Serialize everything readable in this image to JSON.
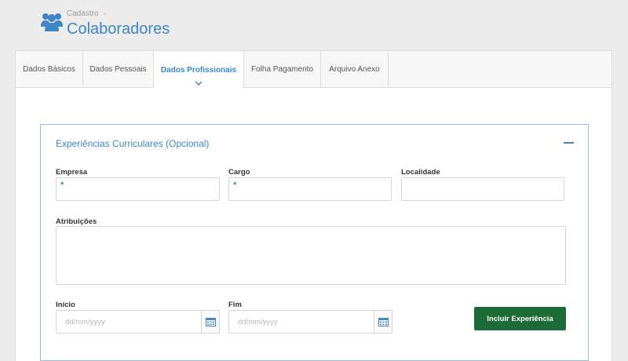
{
  "header": {
    "breadcrumb": "Cadastro",
    "title": "Colaboradores",
    "icon": "people-icon"
  },
  "tabs": [
    {
      "label": "Dados Básicos",
      "active": false
    },
    {
      "label": "Dados Pessoais",
      "active": false
    },
    {
      "label": "Dados Profissionais",
      "active": true
    },
    {
      "label": "Folha Pagamento",
      "active": false
    },
    {
      "label": "Arquivo Anexo",
      "active": false
    }
  ],
  "panel": {
    "title": "Experiências Curriculares (Opcional)",
    "fields": {
      "empresa": {
        "label": "Empresa",
        "value": "",
        "required_mark": "*"
      },
      "cargo": {
        "label": "Cargo",
        "value": "",
        "required_mark": "*"
      },
      "localidade": {
        "label": "Localidade",
        "value": ""
      },
      "atribuicoes": {
        "label": "Atribuições",
        "value": ""
      },
      "inicio": {
        "label": "Início",
        "placeholder": "dd/mm/yyyy"
      },
      "fim": {
        "label": "Fim",
        "placeholder": "dd/mm/yyyy"
      }
    },
    "add_button_label": "Incluir Experiência"
  },
  "colors": {
    "accent": "#3f86c6",
    "primary_button": "#1e6b3a",
    "panel_border": "#8fc1e0"
  }
}
